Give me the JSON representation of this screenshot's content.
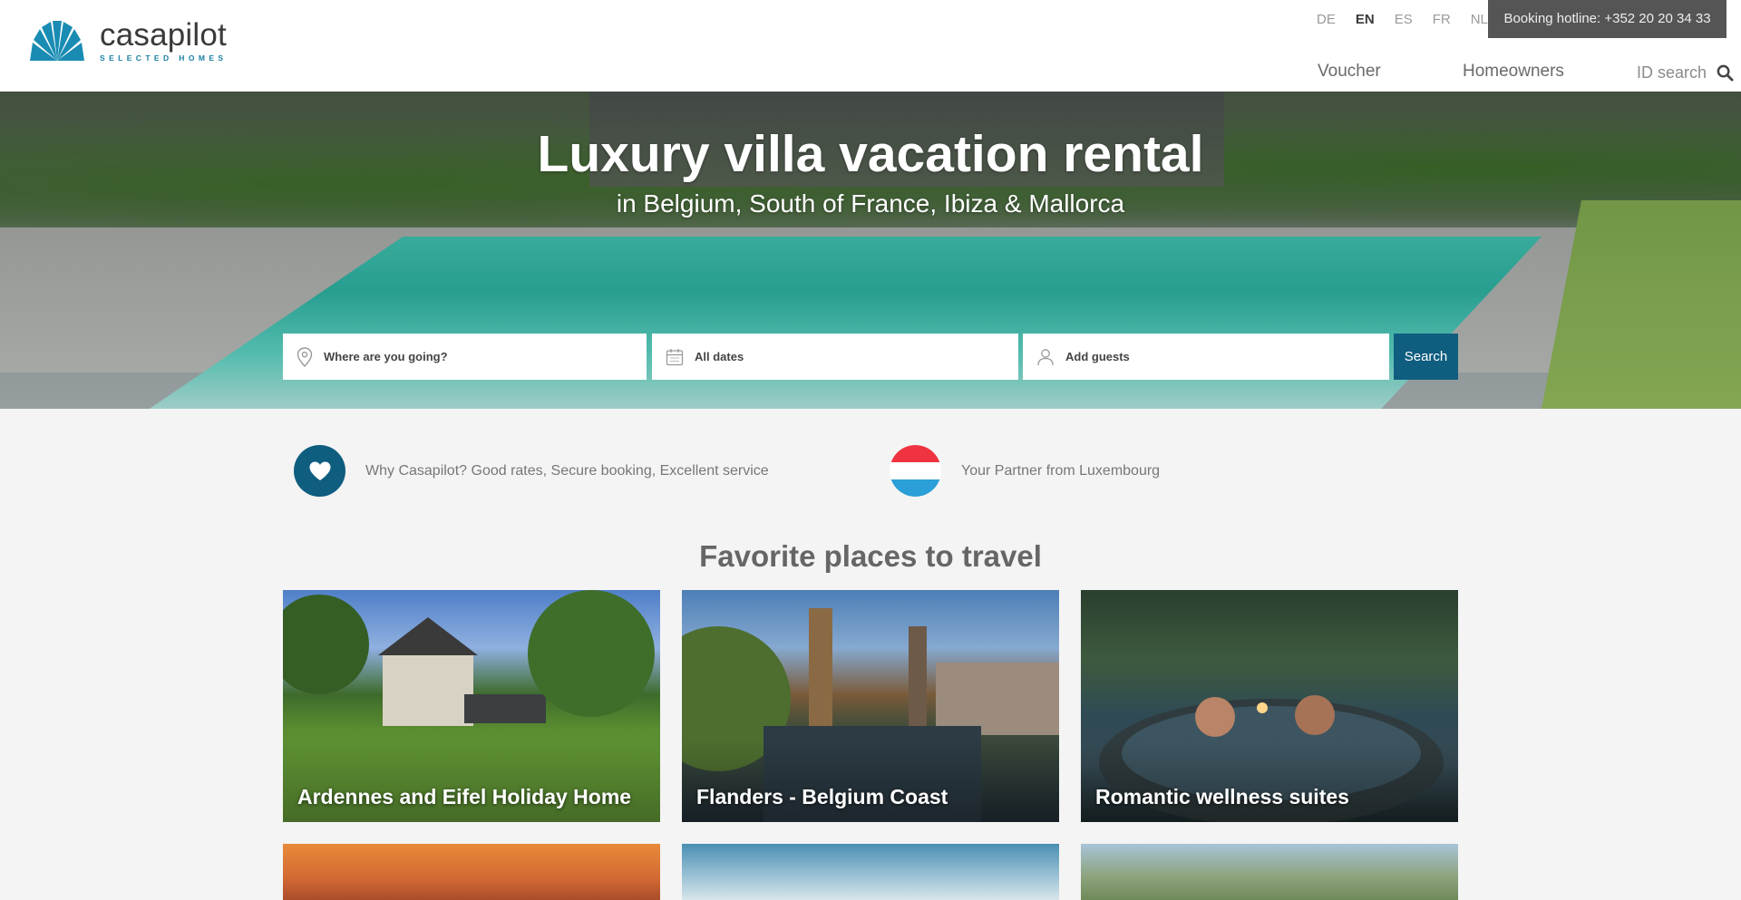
{
  "header": {
    "brand": {
      "name": "casapilot",
      "tagline": "SELECTED HOMES"
    },
    "languages": [
      {
        "code": "DE",
        "active": false
      },
      {
        "code": "EN",
        "active": true
      },
      {
        "code": "ES",
        "active": false
      },
      {
        "code": "FR",
        "active": false
      },
      {
        "code": "NL",
        "active": false
      }
    ],
    "hotline": "Booking hotline: +352 20 20 34 33",
    "nav": {
      "voucher": "Voucher",
      "homeowners": "Homeowners",
      "id_search": "ID search"
    }
  },
  "hero": {
    "title": "Luxury villa vacation rental",
    "subtitle": "in Belgium, South of France, Ibiza & Mallorca"
  },
  "search": {
    "where_placeholder": "Where are you going?",
    "dates": "All dates",
    "guests": "Add guests",
    "button": "Search"
  },
  "features": {
    "why": "Why Casapilot? Good rates, Secure booking, Excellent service",
    "partner": "Your Partner from Luxembourg"
  },
  "favorites": {
    "title": "Favorite places to travel",
    "cards": [
      {
        "label": "Ardennes and Eifel Holiday Home"
      },
      {
        "label": "Flanders - Belgium Coast"
      },
      {
        "label": "Romantic wellness suites"
      },
      {
        "label": ""
      },
      {
        "label": ""
      },
      {
        "label": ""
      }
    ]
  },
  "colors": {
    "brand": "#0f5d7f",
    "hotline_bg": "#555555",
    "page_bg": "#f4f4f4"
  },
  "icons": [
    "casapilot-logo",
    "search-icon",
    "map-pin-icon",
    "calendar-icon",
    "user-icon",
    "heart-icon",
    "luxembourg-flag"
  ]
}
